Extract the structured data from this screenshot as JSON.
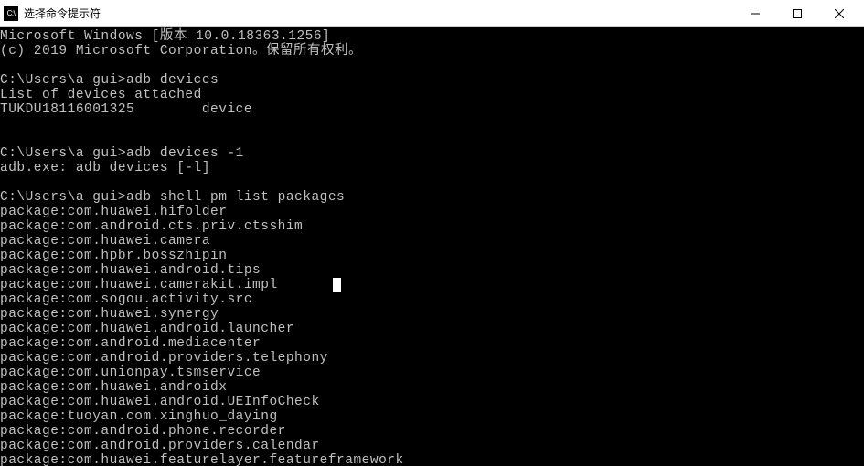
{
  "titlebar": {
    "icon_label": "C:\\",
    "title": "选择命令提示符",
    "minimize": "─",
    "maximize": "☐",
    "close": "✕"
  },
  "terminal_lines": [
    "Microsoft Windows [版本 10.0.18363.1256]",
    "(c) 2019 Microsoft Corporation。保留所有权利。",
    "",
    "C:\\Users\\a gui>adb devices",
    "List of devices attached",
    "TUKDU18116001325        device",
    "",
    "",
    "C:\\Users\\a gui>adb devices -1",
    "adb.exe: adb devices [-l]",
    "",
    "C:\\Users\\a gui>adb shell pm list packages",
    "package:com.huawei.hifolder",
    "package:com.android.cts.priv.ctsshim",
    "package:com.huawei.camera",
    "package:com.hpbr.bosszhipin",
    "package:com.huawei.android.tips",
    "package:com.huawei.camerakit.impl",
    "package:com.sogou.activity.src",
    "package:com.huawei.synergy",
    "package:com.huawei.android.launcher",
    "package:com.android.mediacenter",
    "package:com.android.providers.telephony",
    "package:com.unionpay.tsmservice",
    "package:com.huawei.androidx",
    "package:com.huawei.android.UEInfoCheck",
    "package:tuoyan.com.xinghuo_daying",
    "package:com.android.phone.recorder",
    "package:com.android.providers.calendar",
    "package:com.huawei.featurelayer.featureframework"
  ],
  "cursor_line_index": 17
}
